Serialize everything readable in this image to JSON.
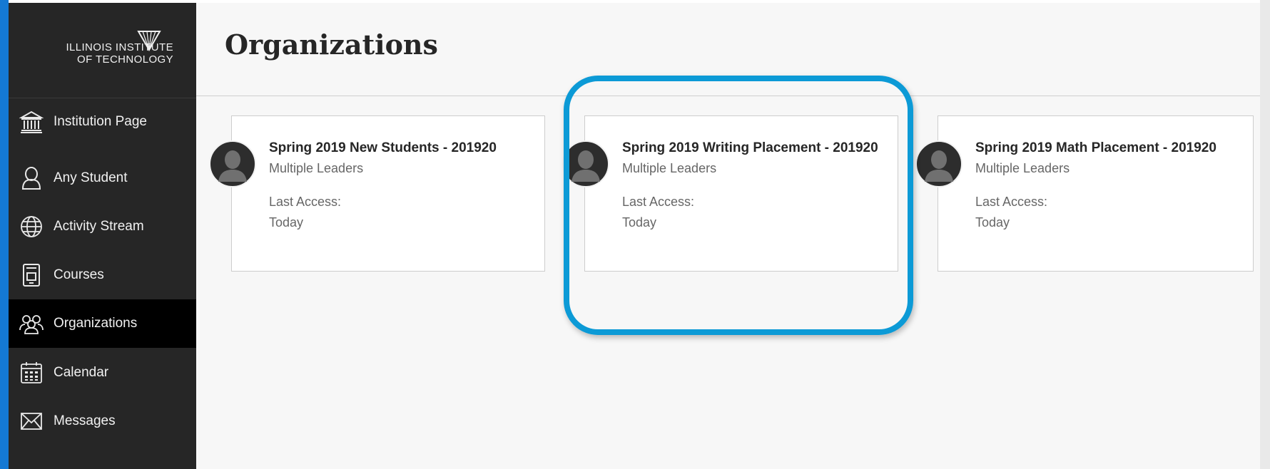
{
  "brand": {
    "line1": "ILLINOIS INSTITUTE",
    "line2": "OF TECHNOLOGY"
  },
  "nav": [
    {
      "label": "Institution Page",
      "icon": "institution-icon"
    },
    {
      "label": "Any Student",
      "icon": "user-icon"
    },
    {
      "label": "Activity Stream",
      "icon": "globe-icon"
    },
    {
      "label": "Courses",
      "icon": "courses-icon"
    },
    {
      "label": "Organizations",
      "icon": "organizations-icon",
      "active": true
    },
    {
      "label": "Calendar",
      "icon": "calendar-icon"
    },
    {
      "label": "Messages",
      "icon": "envelope-icon"
    }
  ],
  "page": {
    "title": "Organizations"
  },
  "cards": [
    {
      "title": "Spring 2019 New Students - 201920",
      "leaders": "Multiple Leaders",
      "last_access_label": "Last Access:",
      "last_access_value": "Today"
    },
    {
      "title": "Spring 2019 Writing Placement - 201920",
      "leaders": "Multiple Leaders",
      "last_access_label": "Last Access:",
      "last_access_value": "Today"
    },
    {
      "title": "Spring 2019 Math Placement - 201920",
      "leaders": "Multiple Leaders",
      "last_access_label": "Last Access:",
      "last_access_value": "Today"
    }
  ],
  "colors": {
    "sidebar_bg": "#262626",
    "sidebar_active": "#000000",
    "highlight": "#0c9ad6",
    "left_edge": "#1479d4"
  }
}
